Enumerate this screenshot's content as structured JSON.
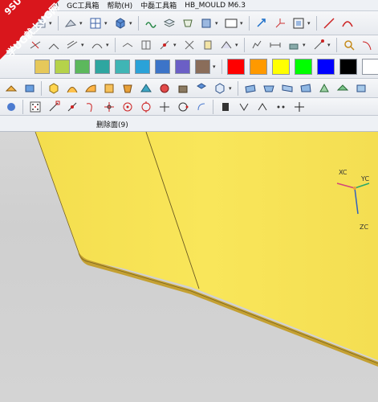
{
  "menu": {
    "items": [
      "窗口(O)",
      "GC工具箱",
      "帮助(H)",
      "中磊工具箱",
      "HB_MOULD M6.3"
    ]
  },
  "watermark": {
    "line1": "9SUG",
    "line2": "学UG就上UG网"
  },
  "status": {
    "message": "删除面(9)"
  },
  "palette": {
    "muted": [
      "#e6c85a",
      "#b5d24a",
      "#5cb85c",
      "#2ea6a0",
      "#3fb5b5",
      "#2aa2d8",
      "#3c74c8",
      "#6b5fc6",
      "#8a6d5a"
    ],
    "bright": [
      "#ff0000",
      "#ff9900",
      "#ffff00",
      "#00ff00",
      "#0000ff",
      "#000000",
      "#ffffff"
    ]
  },
  "viewport": {
    "part_color": "#f7e35a",
    "background_color": "#d3d3d3"
  },
  "wcs": {
    "xc": "XC",
    "yc": "YC",
    "zc": "ZC"
  }
}
